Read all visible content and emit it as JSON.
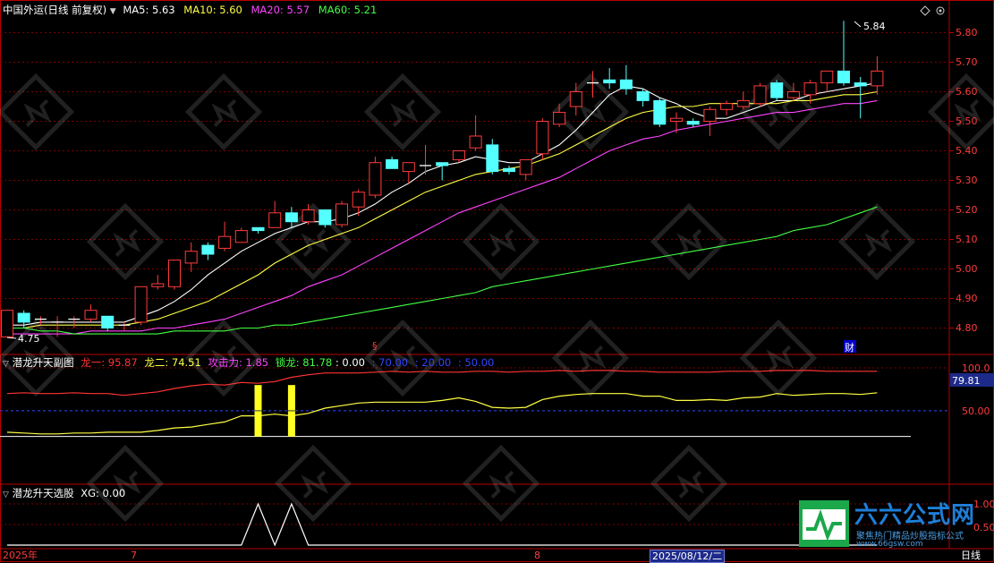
{
  "header": {
    "title": "中国外运(日线 前复权)",
    "ma": [
      {
        "label": "MA5: 5.63",
        "color": "#ffffff"
      },
      {
        "label": "MA10: 5.60",
        "color": "#ffff44"
      },
      {
        "label": "MA20: 5.57",
        "color": "#ff44ff"
      },
      {
        "label": "MA60: 5.21",
        "color": "#44ff44"
      }
    ]
  },
  "main_axis": {
    "ticks": [
      "5.80",
      "5.70",
      "5.60",
      "5.50",
      "5.40",
      "5.30",
      "5.20",
      "5.10",
      "5.00",
      "4.90",
      "4.80"
    ],
    "high_label": "5.84",
    "low_label": "4.75",
    "event_cai": "财",
    "event_mark": "§"
  },
  "indicator1": {
    "name": "潜龙升天副图",
    "items": [
      {
        "label": "龙一: 95.87",
        "color": "#ff3333"
      },
      {
        "label": "龙二: 74.51",
        "color": "#ffff44"
      },
      {
        "label": "攻击力: 1.85",
        "color": "#ff44ff"
      },
      {
        "label": "锁龙: 81.78",
        "color": "#44ff44"
      },
      {
        "label": ": 0.00",
        "color": "#ffffff"
      },
      {
        "label": ": 70.00",
        "color": "#3344ff"
      },
      {
        "label": ": 20.00",
        "color": "#3344ff"
      },
      {
        "label": ": 50.00",
        "color": "#3344ff"
      }
    ],
    "ticks": [
      "100.0",
      "50.00"
    ],
    "current_value": "79.81"
  },
  "indicator2": {
    "name": "潜龙升天选股",
    "items": [
      {
        "label": "XG: 0.00",
        "color": "#ffffff"
      }
    ],
    "ticks": [
      "1.00",
      "0.50"
    ]
  },
  "date_axis": {
    "labels": [
      "2025年",
      "7",
      "8"
    ],
    "highlight": "2025/08/12/二",
    "period": "日线"
  },
  "watermark": {
    "brand": "六六公式网",
    "slogan": "聚焦热门精品炒股指标公式",
    "url": "www.66gsw.com"
  },
  "colors": {
    "up": "#ff3b3b",
    "down": "#54ffff",
    "grid": "#7a0000",
    "frame": "#b40000"
  },
  "chart_data": [
    {
      "type": "candlestick",
      "title": "中国外运(日线 前复权)",
      "ylim": [
        4.72,
        5.86
      ],
      "candles": [
        {
          "o": 4.77,
          "c": 4.86,
          "h": 4.86,
          "l": 4.77
        },
        {
          "o": 4.85,
          "c": 4.82,
          "h": 4.86,
          "l": 4.8
        },
        {
          "o": 4.83,
          "c": 4.83,
          "h": 4.84,
          "l": 4.81
        },
        {
          "o": 4.82,
          "c": 4.82,
          "h": 4.84,
          "l": 4.77
        },
        {
          "o": 4.83,
          "c": 4.83,
          "h": 4.84,
          "l": 4.8
        },
        {
          "o": 4.83,
          "c": 4.86,
          "h": 4.88,
          "l": 4.82
        },
        {
          "o": 4.84,
          "c": 4.8,
          "h": 4.84,
          "l": 4.79
        },
        {
          "o": 4.81,
          "c": 4.81,
          "h": 4.82,
          "l": 4.79
        },
        {
          "o": 4.82,
          "c": 4.94,
          "h": 4.94,
          "l": 4.81
        },
        {
          "o": 4.94,
          "c": 4.95,
          "h": 4.98,
          "l": 4.93
        },
        {
          "o": 4.94,
          "c": 5.03,
          "h": 5.03,
          "l": 4.93
        },
        {
          "o": 5.02,
          "c": 5.06,
          "h": 5.09,
          "l": 4.99
        },
        {
          "o": 5.08,
          "c": 5.05,
          "h": 5.09,
          "l": 5.03
        },
        {
          "o": 5.07,
          "c": 5.11,
          "h": 5.16,
          "l": 5.06
        },
        {
          "o": 5.09,
          "c": 5.13,
          "h": 5.14,
          "l": 5.09
        },
        {
          "o": 5.14,
          "c": 5.13,
          "h": 5.14,
          "l": 5.12
        },
        {
          "o": 5.14,
          "c": 5.19,
          "h": 5.23,
          "l": 5.14
        },
        {
          "o": 5.19,
          "c": 5.16,
          "h": 5.21,
          "l": 5.14
        },
        {
          "o": 5.16,
          "c": 5.2,
          "h": 5.22,
          "l": 5.15
        },
        {
          "o": 5.2,
          "c": 5.15,
          "h": 5.2,
          "l": 5.14
        },
        {
          "o": 5.15,
          "c": 5.22,
          "h": 5.23,
          "l": 5.14
        },
        {
          "o": 5.21,
          "c": 5.26,
          "h": 5.27,
          "l": 5.18
        },
        {
          "o": 5.25,
          "c": 5.36,
          "h": 5.38,
          "l": 5.24
        },
        {
          "o": 5.37,
          "c": 5.34,
          "h": 5.38,
          "l": 5.34
        },
        {
          "o": 5.33,
          "c": 5.36,
          "h": 5.36,
          "l": 5.29
        },
        {
          "o": 5.35,
          "c": 5.35,
          "h": 5.42,
          "l": 5.32
        },
        {
          "o": 5.36,
          "c": 5.35,
          "h": 5.36,
          "l": 5.3
        },
        {
          "o": 5.37,
          "c": 5.4,
          "h": 5.4,
          "l": 5.36
        },
        {
          "o": 5.41,
          "c": 5.45,
          "h": 5.52,
          "l": 5.4
        },
        {
          "o": 5.42,
          "c": 5.33,
          "h": 5.44,
          "l": 5.32
        },
        {
          "o": 5.34,
          "c": 5.33,
          "h": 5.35,
          "l": 5.32
        },
        {
          "o": 5.32,
          "c": 5.37,
          "h": 5.37,
          "l": 5.3
        },
        {
          "o": 5.39,
          "c": 5.5,
          "h": 5.51,
          "l": 5.37
        },
        {
          "o": 5.49,
          "c": 5.53,
          "h": 5.56,
          "l": 5.48
        },
        {
          "o": 5.55,
          "c": 5.6,
          "h": 5.63,
          "l": 5.52
        },
        {
          "o": 5.63,
          "c": 5.63,
          "h": 5.67,
          "l": 5.58
        },
        {
          "o": 5.64,
          "c": 5.63,
          "h": 5.68,
          "l": 5.61
        },
        {
          "o": 5.64,
          "c": 5.61,
          "h": 5.69,
          "l": 5.59
        },
        {
          "o": 5.6,
          "c": 5.57,
          "h": 5.61,
          "l": 5.55
        },
        {
          "o": 5.57,
          "c": 5.49,
          "h": 5.58,
          "l": 5.48
        },
        {
          "o": 5.5,
          "c": 5.51,
          "h": 5.53,
          "l": 5.46
        },
        {
          "o": 5.5,
          "c": 5.49,
          "h": 5.51,
          "l": 5.48
        },
        {
          "o": 5.5,
          "c": 5.54,
          "h": 5.55,
          "l": 5.45
        },
        {
          "o": 5.54,
          "c": 5.56,
          "h": 5.57,
          "l": 5.52
        },
        {
          "o": 5.55,
          "c": 5.57,
          "h": 5.6,
          "l": 5.54
        },
        {
          "o": 5.56,
          "c": 5.62,
          "h": 5.63,
          "l": 5.55
        },
        {
          "o": 5.63,
          "c": 5.58,
          "h": 5.64,
          "l": 5.57
        },
        {
          "o": 5.58,
          "c": 5.6,
          "h": 5.63,
          "l": 5.57
        },
        {
          "o": 5.59,
          "c": 5.63,
          "h": 5.64,
          "l": 5.56
        },
        {
          "o": 5.63,
          "c": 5.67,
          "h": 5.67,
          "l": 5.6
        },
        {
          "o": 5.67,
          "c": 5.63,
          "h": 5.84,
          "l": 5.62
        },
        {
          "o": 5.63,
          "c": 5.62,
          "h": 5.65,
          "l": 5.51
        },
        {
          "o": 5.62,
          "c": 5.67,
          "h": 5.72,
          "l": 5.59
        }
      ],
      "series": [
        {
          "name": "MA5",
          "values": [
            4.81,
            4.81,
            4.82,
            4.82,
            4.82,
            4.82,
            4.82,
            4.82,
            4.84,
            4.86,
            4.89,
            4.93,
            4.98,
            5.02,
            5.06,
            5.09,
            5.12,
            5.14,
            5.16,
            5.16,
            5.17,
            5.19,
            5.22,
            5.26,
            5.29,
            5.33,
            5.35,
            5.36,
            5.38,
            5.37,
            5.36,
            5.36,
            5.39,
            5.42,
            5.47,
            5.53,
            5.59,
            5.62,
            5.61,
            5.58,
            5.56,
            5.53,
            5.51,
            5.51,
            5.53,
            5.55,
            5.57,
            5.57,
            5.59,
            5.6,
            5.61,
            5.62,
            5.63
          ]
        },
        {
          "name": "MA10",
          "values": [
            4.8,
            4.8,
            4.81,
            4.81,
            4.81,
            4.81,
            4.81,
            4.81,
            4.82,
            4.83,
            4.85,
            4.87,
            4.89,
            4.92,
            4.95,
            4.98,
            5.02,
            5.05,
            5.08,
            5.1,
            5.12,
            5.14,
            5.17,
            5.2,
            5.23,
            5.26,
            5.28,
            5.3,
            5.32,
            5.33,
            5.34,
            5.35,
            5.37,
            5.39,
            5.42,
            5.45,
            5.48,
            5.51,
            5.53,
            5.54,
            5.55,
            5.55,
            5.56,
            5.56,
            5.56,
            5.56,
            5.56,
            5.57,
            5.57,
            5.58,
            5.59,
            5.59,
            5.6
          ]
        },
        {
          "name": "MA20",
          "values": [
            4.78,
            4.78,
            4.78,
            4.78,
            4.78,
            4.79,
            4.79,
            4.79,
            4.79,
            4.8,
            4.8,
            4.81,
            4.82,
            4.83,
            4.85,
            4.87,
            4.89,
            4.91,
            4.94,
            4.96,
            4.98,
            5.01,
            5.04,
            5.07,
            5.1,
            5.13,
            5.16,
            5.19,
            5.21,
            5.23,
            5.25,
            5.27,
            5.29,
            5.31,
            5.34,
            5.37,
            5.4,
            5.42,
            5.44,
            5.45,
            5.47,
            5.48,
            5.49,
            5.5,
            5.51,
            5.52,
            5.53,
            5.53,
            5.54,
            5.55,
            5.56,
            5.56,
            5.57
          ]
        },
        {
          "name": "MA60",
          "values": [
            4.8,
            4.8,
            4.79,
            4.79,
            4.78,
            4.78,
            4.78,
            4.78,
            4.78,
            4.78,
            4.79,
            4.79,
            4.79,
            4.79,
            4.8,
            4.8,
            4.81,
            4.81,
            4.82,
            4.83,
            4.84,
            4.85,
            4.86,
            4.87,
            4.88,
            4.89,
            4.9,
            4.91,
            4.92,
            4.94,
            4.95,
            4.96,
            4.97,
            4.98,
            4.99,
            5.0,
            5.01,
            5.02,
            5.03,
            5.04,
            5.05,
            5.06,
            5.07,
            5.08,
            5.09,
            5.1,
            5.11,
            5.13,
            5.14,
            5.15,
            5.17,
            5.19,
            5.21
          ]
        }
      ]
    },
    {
      "type": "line",
      "title": "潜龙升天副图",
      "ylim": [
        0,
        100
      ],
      "series": [
        {
          "name": "龙一",
          "values": [
            70,
            71,
            70,
            70,
            71,
            70,
            70,
            68,
            70,
            72,
            76,
            79,
            81,
            80,
            83,
            82,
            84,
            89,
            92,
            94,
            94,
            94,
            95,
            96,
            95,
            96,
            95,
            95,
            96,
            96,
            95,
            96,
            96,
            97,
            96,
            97,
            97,
            96,
            96,
            95,
            95,
            95,
            95,
            96,
            96,
            96,
            97,
            97,
            97,
            96,
            96,
            96,
            96
          ]
        },
        {
          "name": "龙二",
          "values": [
            25,
            24,
            23,
            23,
            24,
            24,
            25,
            25,
            25,
            27,
            30,
            31,
            34,
            37,
            44,
            44,
            46,
            44,
            47,
            53,
            56,
            59,
            60,
            60,
            60,
            60,
            62,
            65,
            61,
            54,
            53,
            54,
            63,
            67,
            69,
            70,
            70,
            70,
            67,
            67,
            62,
            62,
            63,
            62,
            65,
            66,
            70,
            68,
            69,
            70,
            70,
            69,
            71
          ]
        },
        {
          "name": "",
          "values": [
            20,
            20,
            20,
            20,
            20,
            20,
            20,
            20,
            20,
            20,
            20,
            20,
            20,
            20,
            20,
            20,
            20,
            20,
            20,
            20,
            20,
            20,
            20,
            20,
            20,
            20,
            20,
            20,
            20,
            20,
            20,
            20,
            20,
            20,
            20,
            20,
            20,
            20,
            20,
            20,
            20,
            20,
            20,
            20,
            20,
            20,
            20,
            20,
            20,
            20,
            20,
            20,
            20
          ]
        },
        {
          "name": "",
          "values": [
            50,
            50,
            50,
            50,
            50,
            50,
            50,
            50,
            50,
            50,
            50,
            50,
            50,
            50,
            50,
            50,
            50,
            50,
            50,
            50,
            50,
            50,
            50,
            50,
            50,
            50,
            50,
            50,
            50,
            50,
            50,
            50,
            50,
            50,
            50,
            50,
            50,
            50,
            50,
            50,
            50,
            50,
            50,
            50,
            50,
            50,
            50,
            50,
            50,
            50,
            50,
            50,
            50
          ]
        }
      ],
      "bars": [
        {
          "index": 15,
          "from": 20,
          "to": 80
        },
        {
          "index": 17,
          "from": 20,
          "to": 80
        }
      ]
    },
    {
      "type": "line",
      "title": "潜龙升天选股",
      "ylim": [
        0,
        1
      ],
      "series": [
        {
          "name": "XG",
          "values": [
            0,
            0,
            0,
            0,
            0,
            0,
            0,
            0,
            0,
            0,
            0,
            0,
            0,
            0,
            0,
            1,
            0,
            1,
            0,
            0,
            0,
            0,
            0,
            0,
            0,
            0,
            0,
            0,
            0,
            0,
            0,
            0,
            0,
            0,
            0,
            0,
            0,
            0,
            0,
            0,
            0,
            0,
            0,
            0,
            0,
            0,
            0,
            0,
            0,
            0,
            0,
            0,
            0
          ]
        }
      ]
    }
  ]
}
